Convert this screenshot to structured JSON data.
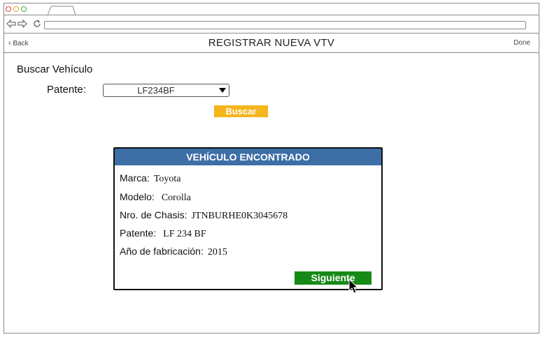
{
  "browser": {
    "back_icon": "back-arrow-icon",
    "forward_icon": "forward-arrow-icon",
    "reload_icon": "reload-icon",
    "url": ""
  },
  "header": {
    "back_label": "Back",
    "title": "REGISTRAR NUEVA VTV",
    "done_label": "Done"
  },
  "search": {
    "section_title": "Buscar Vehículo",
    "patente_label": "Patente:",
    "patente_value": "LF234BF",
    "button_label": "Buscar"
  },
  "result": {
    "header": "VEHÍCULO ENCONTRADO",
    "fields": [
      {
        "label": "Marca:",
        "value": "Toyota"
      },
      {
        "label": "Modelo:",
        "value": "Corolla"
      },
      {
        "label": "Nro. de Chasis:",
        "value": "JTNBURHE0K3045678"
      },
      {
        "label": "Patente:",
        "value": "LF 234 BF"
      },
      {
        "label": "Año de fabricación:",
        "value": "2015"
      }
    ],
    "next_button_label": "Siguiente"
  },
  "colors": {
    "search_button": "#f5b51c",
    "card_header": "#3e6ea6",
    "next_button": "#168a16"
  }
}
